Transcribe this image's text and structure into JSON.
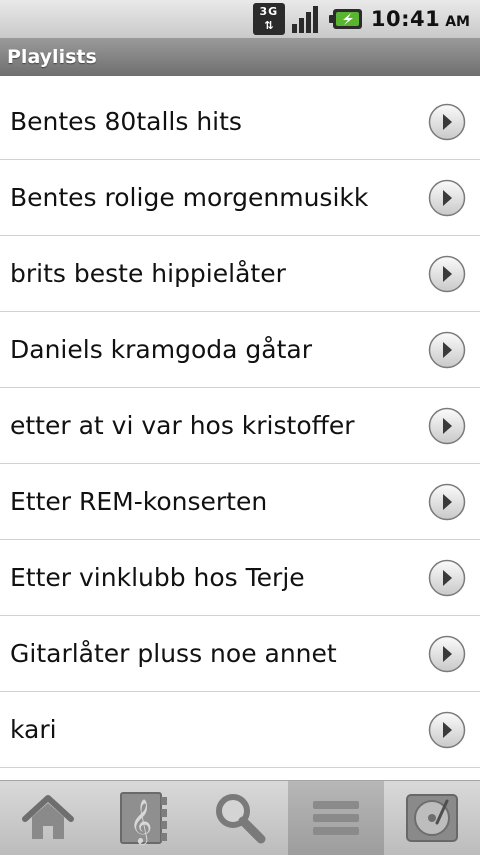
{
  "status_bar": {
    "network_label": "3G",
    "time": "10:41",
    "ampm": "AM",
    "icons": [
      "3g-data-icon",
      "signal-strength-icon",
      "battery-charging-icon"
    ],
    "battery_color": "#59b52f"
  },
  "title": "Playlists",
  "playlists": [
    {
      "label": "Bentes 80talls hits"
    },
    {
      "label": "Bentes rolige morgenmusikk"
    },
    {
      "label": "brits beste hippielåter"
    },
    {
      "label": "Daniels kramgoda gåtar"
    },
    {
      "label": "etter at vi var hos kristoffer"
    },
    {
      "label": "Etter REM-konserten"
    },
    {
      "label": "Etter vinklubb hos Terje"
    },
    {
      "label": "Gitarlåter pluss noe annet"
    },
    {
      "label": "kari"
    }
  ],
  "toolbar": {
    "items": [
      {
        "icon": "home-icon",
        "active": false
      },
      {
        "icon": "music-library-icon",
        "active": false
      },
      {
        "icon": "search-icon",
        "active": false
      },
      {
        "icon": "playlists-icon",
        "active": true
      },
      {
        "icon": "now-playing-icon",
        "active": false
      }
    ]
  }
}
